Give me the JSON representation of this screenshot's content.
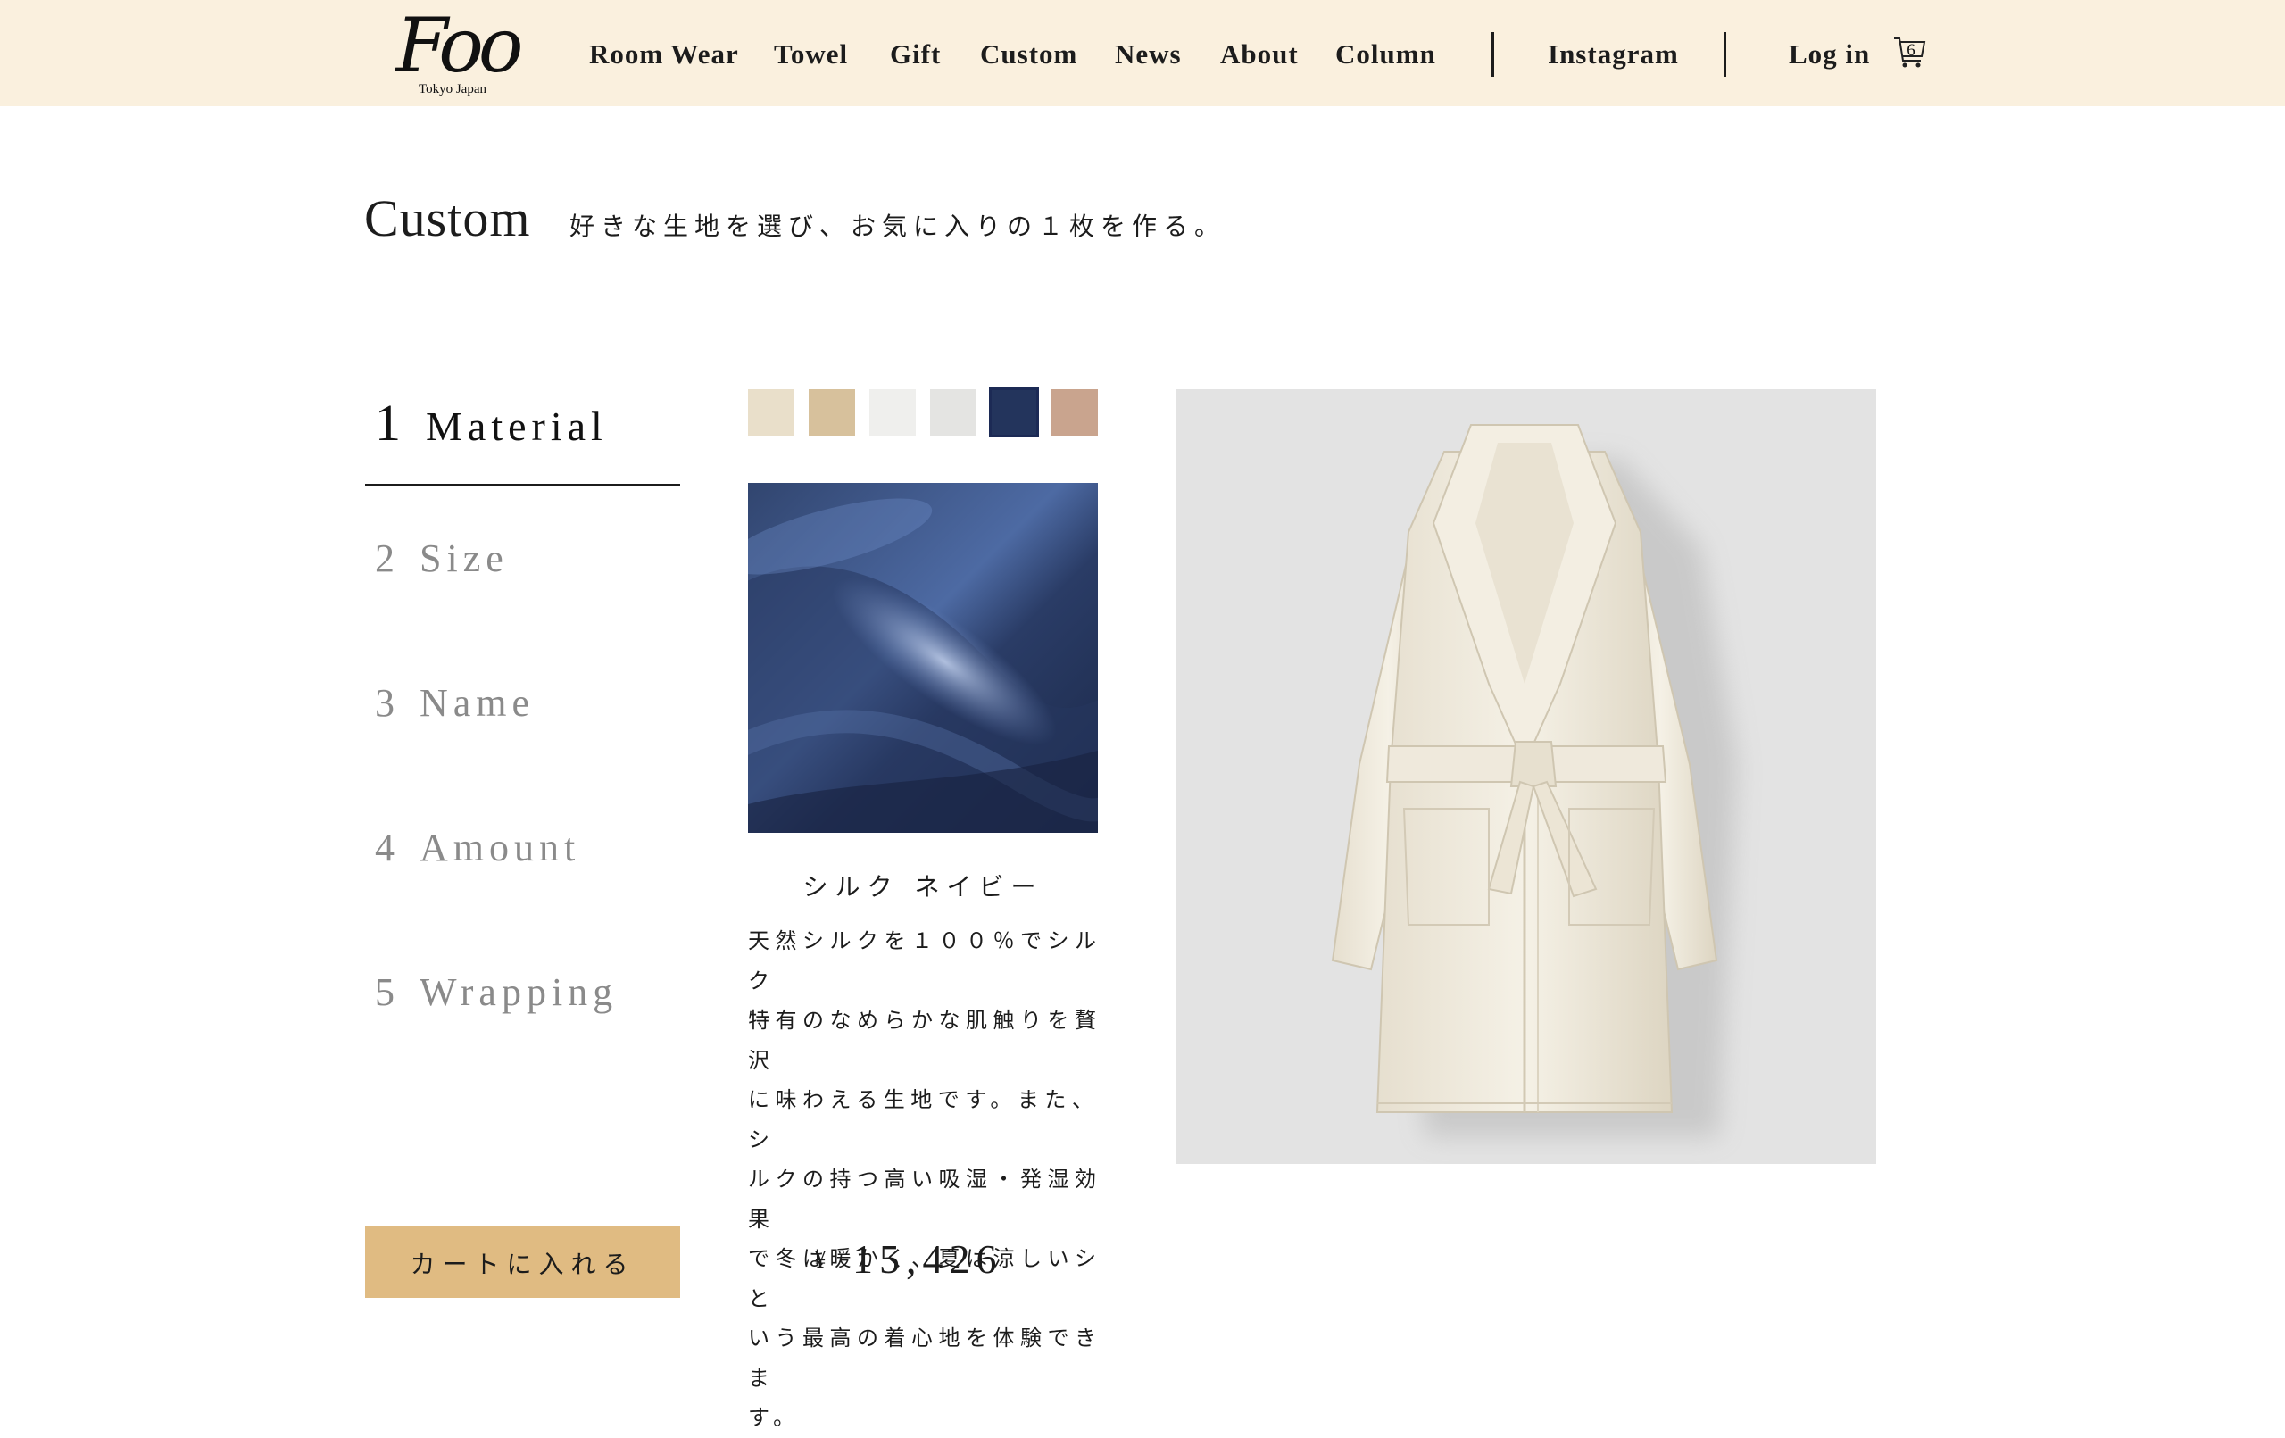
{
  "header": {
    "logo": {
      "script": "Foo",
      "sub": "Tokyo Japan"
    },
    "nav": [
      {
        "label": "Room Wear"
      },
      {
        "label": "Towel"
      },
      {
        "label": "Gift"
      },
      {
        "label": "Custom"
      },
      {
        "label": "News"
      },
      {
        "label": "About"
      },
      {
        "label": "Column"
      }
    ],
    "instagram": "Instagram",
    "login": "Log in",
    "cart_count": "6"
  },
  "page": {
    "title": "Custom",
    "subtitle": "好きな生地を選び、お気に入りの１枚を作る。"
  },
  "steps": [
    {
      "num": "1",
      "label": "Material",
      "active": true
    },
    {
      "num": "2",
      "label": "Size",
      "active": false
    },
    {
      "num": "3",
      "label": "Name",
      "active": false
    },
    {
      "num": "4",
      "label": "Amount",
      "active": false
    },
    {
      "num": "5",
      "label": "Wrapping",
      "active": false
    }
  ],
  "cart_button": "カートに入れる",
  "swatches": [
    {
      "color": "#e9dfca",
      "selected": false
    },
    {
      "color": "#d7c19c",
      "selected": false
    },
    {
      "color": "#efefed",
      "selected": false
    },
    {
      "color": "#e4e4e2",
      "selected": false
    },
    {
      "color": "#23345c",
      "selected": true
    },
    {
      "color": "#c9a48e",
      "selected": false
    }
  ],
  "material": {
    "name": "シルク ネイビー",
    "description_lines": [
      "天然シルクを１００％でシルク",
      "特有のなめらかな肌触りを贅沢",
      "に味わえる生地です。また、シ",
      "ルクの持つ高い吸湿・発湿効果",
      "で冬は暖かく、夏は涼しいシと",
      "いう最高の着心地を体験できま",
      "す。"
    ]
  },
  "price": {
    "currency": "¥",
    "amount": "15,426"
  },
  "colors": {
    "header_bg": "#faf0de",
    "button_bg": "#e0bb82",
    "selected_outline": "#1c2a55"
  }
}
